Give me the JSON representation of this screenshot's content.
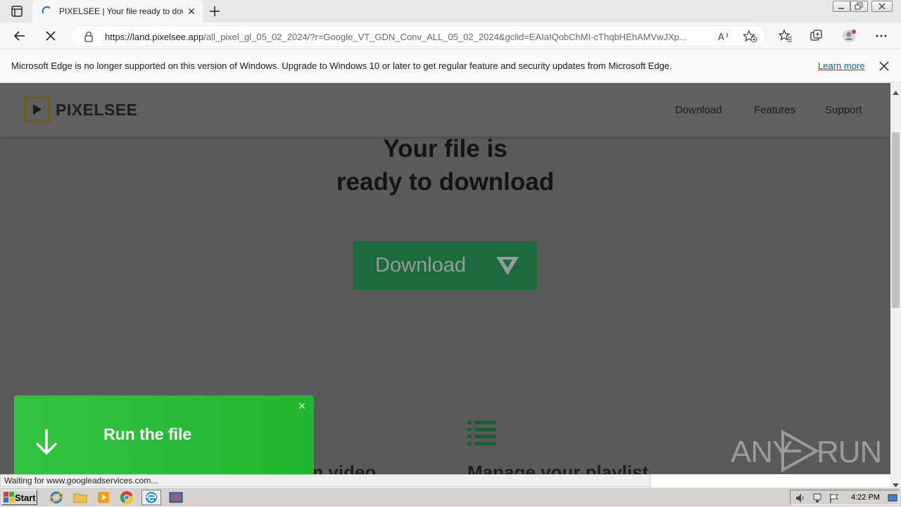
{
  "browser": {
    "tab_title": "PIXELSEE | Your file ready to download",
    "url_host": "https://land.pixelsee.app",
    "url_path": "/all_pixel_gl_05_02_2024/?r=Google_VT_GDN_Conv_ALL_05_02_2024&gclid=EAIaIQobChMI-cThqbHEhAMVwJXp...",
    "status_text": "Waiting for www.googleadservices.com..."
  },
  "infobar": {
    "message": "Microsoft Edge is no longer supported on this version of Windows. Upgrade to Windows 10 or later to get regular feature and security updates from Microsoft Edge.",
    "link": "Learn more"
  },
  "site": {
    "logo": "PIXELSEE",
    "nav": [
      "Download",
      "Features",
      "Support"
    ],
    "hero_line1": "Your file is",
    "hero_line2": "ready to download",
    "download_button": "Download",
    "feature1_title": "m video",
    "feature2_title": "Manage your playlist"
  },
  "popup": {
    "label": "Run the file",
    "close": "×"
  },
  "watermark": {
    "left": "ANY",
    "right": "RUN"
  },
  "taskbar": {
    "start": "Start",
    "clock": "4:22 PM"
  },
  "colors": {
    "popup_green": "#2bbd39",
    "download_green": "#1b6b3e",
    "overlay": "#5a5a5a",
    "logo_gold": "#6f5c12"
  }
}
